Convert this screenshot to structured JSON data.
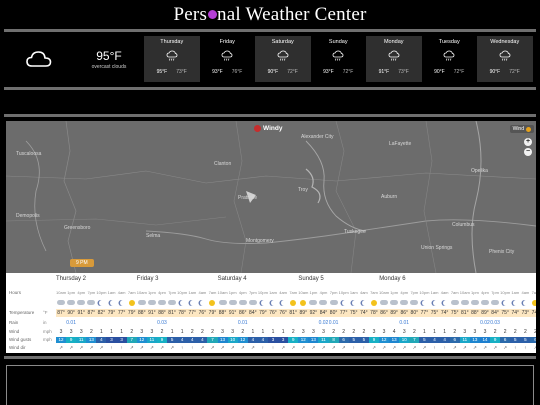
{
  "title": {
    "before": "Pers",
    "after": "nal Weather Center"
  },
  "current": {
    "icon": "cloud-icon",
    "temp": "95°F",
    "condition": "overcast clouds"
  },
  "days": [
    {
      "name": "Thursday",
      "high": "95°F",
      "low": "73°F",
      "icon": "rain-cloud-icon"
    },
    {
      "name": "Friday",
      "high": "93°F",
      "low": "76°F",
      "icon": "rain-cloud-icon"
    },
    {
      "name": "Saturday",
      "high": "90°F",
      "low": "72°F",
      "icon": "rain-cloud-icon"
    },
    {
      "name": "Sunday",
      "high": "93°F",
      "low": "72°F",
      "icon": "rain-cloud-icon"
    },
    {
      "name": "Monday",
      "high": "91°F",
      "low": "73°F",
      "icon": "rain-cloud-icon"
    },
    {
      "name": "Tuesday",
      "high": "90°F",
      "low": "72°F",
      "icon": "rain-cloud-icon"
    },
    {
      "name": "Wednesday",
      "high": "90°F",
      "low": "72°F",
      "icon": "rain-cloud-icon"
    }
  ],
  "map": {
    "brand": "Windy",
    "layer_button": "Wind",
    "zoom_in": "+",
    "zoom_out": "−",
    "time_marker": "9 PM",
    "cities": [
      "Tuscaloosa",
      "Alexander City",
      "LaFayette",
      "Opelika",
      "Auburn",
      "Tuskegee",
      "Montgomery",
      "Prattville",
      "Selma",
      "Clanton",
      "Columbus",
      "Phenix City",
      "Demopolis",
      "Greensboro",
      "Troy",
      "Union Springs"
    ]
  },
  "forecast": {
    "day_labels": [
      "Thursday 2",
      "Friday 3",
      "Saturday 4",
      "Sunday 5",
      "Monday 6"
    ],
    "row_labels": {
      "hours": "Hours",
      "temp": "Temperature",
      "rain": "Rain",
      "wind": "Wind",
      "gusts": "Wind gusts",
      "dir": "Wind dir"
    },
    "units": {
      "hours": "",
      "temp": "°F",
      "rain": "in",
      "wind": "mph",
      "gusts": "mph",
      "dir": ""
    },
    "hours": [
      "10am",
      "1pm",
      "4pm",
      "7pm",
      "10pm",
      "1am",
      "4am",
      "7am",
      "10am",
      "1pm",
      "4pm",
      "7pm",
      "10pm",
      "1am",
      "4am",
      "7am",
      "10am",
      "1pm",
      "4pm",
      "7pm",
      "10pm",
      "1am",
      "4am",
      "7am",
      "10am",
      "1pm",
      "4pm",
      "7pm",
      "10pm",
      "1am",
      "4am",
      "7am",
      "10am",
      "1pm",
      "4pm",
      "7pm",
      "10pm",
      "1am",
      "4am",
      "7am",
      "10am",
      "1pm",
      "4pm",
      "7pm",
      "10pm",
      "1am",
      "4am",
      "7am"
    ],
    "icons": [
      "pcloud",
      "pcloud",
      "pcloud",
      "pcloud",
      "moon",
      "moon",
      "moon",
      "sun",
      "pcloud",
      "pcloud",
      "pcloud",
      "pcloud",
      "moon",
      "moon",
      "moon",
      "sun",
      "pcloud",
      "pcloud",
      "pcloud",
      "pcloud",
      "moon",
      "moon",
      "moon",
      "sun",
      "sun",
      "pcloud",
      "pcloud",
      "pcloud",
      "moon",
      "moon",
      "moon",
      "sun",
      "pcloud",
      "pcloud",
      "pcloud",
      "pcloud",
      "moon",
      "moon",
      "moon",
      "pcloud",
      "pcloud",
      "pcloud",
      "pcloud",
      "pcloud",
      "moon",
      "moon",
      "moon",
      "sun"
    ],
    "temps": [
      "87°",
      "90°",
      "91°",
      "87°",
      "82°",
      "79°",
      "77°",
      "79°",
      "88°",
      "91°",
      "88°",
      "81°",
      "78°",
      "77°",
      "76°",
      "79°",
      "88°",
      "91°",
      "86°",
      "84°",
      "79°",
      "76°",
      "76°",
      "81°",
      "89°",
      "92°",
      "84°",
      "80°",
      "77°",
      "75°",
      "74°",
      "78°",
      "86°",
      "89°",
      "86°",
      "80°",
      "77°",
      "75°",
      "74°",
      "75°",
      "81°",
      "88°",
      "89°",
      "84°",
      "75°",
      "74°",
      "73°",
      "74°"
    ],
    "rain": [
      "",
      "0.01",
      "",
      "",
      "",
      "",
      "",
      "",
      "",
      "",
      "0.03",
      "",
      "",
      "",
      "",
      "",
      "",
      "",
      "0.01",
      "",
      "",
      "",
      "",
      "",
      "",
      "",
      "0.02",
      "0.01",
      "",
      "",
      "",
      "",
      "",
      "",
      "0.01",
      "",
      "",
      "",
      "",
      "",
      "",
      "",
      "0.02",
      "0.03",
      "",
      "",
      "",
      ""
    ],
    "wind": [
      "3",
      "3",
      "3",
      "2",
      "1",
      "1",
      "1",
      "2",
      "3",
      "3",
      "2",
      "1",
      "1",
      "2",
      "2",
      "2",
      "3",
      "3",
      "2",
      "1",
      "1",
      "1",
      "1",
      "2",
      "3",
      "3",
      "3",
      "2",
      "2",
      "2",
      "2",
      "3",
      "3",
      "4",
      "3",
      "2",
      "1",
      "1",
      "1",
      "2",
      "3",
      "3",
      "3",
      "2",
      "2",
      "2",
      "2",
      "2"
    ],
    "gusts": [
      "12",
      "9",
      "11",
      "13",
      "4",
      "3",
      "3",
      "7",
      "12",
      "11",
      "9",
      "5",
      "4",
      "4",
      "4",
      "7",
      "13",
      "10",
      "12",
      "4",
      "4",
      "3",
      "3",
      "9",
      "12",
      "13",
      "11",
      "8",
      "6",
      "5",
      "5",
      "9",
      "12",
      "13",
      "10",
      "7",
      "5",
      "4",
      "4",
      "6",
      "11",
      "13",
      "14",
      "9",
      "6",
      "5",
      "5",
      "6"
    ],
    "gust_colors": [
      "#1f8fd1",
      "#17b0c4",
      "#1aa7c8",
      "#1f8fd1",
      "#2b5fa8",
      "#2a4fa0",
      "#2a4fa0",
      "#21a7b6",
      "#1f8fd1",
      "#1aa7c8",
      "#17b0c4",
      "#2b5fa8",
      "#2b5fa8",
      "#2b5fa8",
      "#2b5fa8",
      "#21a7b6",
      "#1e86cf",
      "#1aa7c8",
      "#1f8fd1",
      "#2b5fa8",
      "#2b5fa8",
      "#2a4fa0",
      "#2a4fa0",
      "#17b0c4",
      "#1f8fd1",
      "#1e86cf",
      "#1aa7c8",
      "#21a7b6",
      "#2b6aab",
      "#2b5fa8",
      "#2b5fa8",
      "#17b0c4",
      "#1f8fd1",
      "#1e86cf",
      "#1aa7c8",
      "#21a7b6",
      "#2b5fa8",
      "#2b5fa8",
      "#2b5fa8",
      "#2b6aab",
      "#1aa7c8",
      "#1e86cf",
      "#1d7fcf",
      "#17b0c4",
      "#2b6aab",
      "#2b5fa8",
      "#2b5fa8",
      "#2b6aab"
    ],
    "dirs": [
      "↗",
      "↗",
      "↗",
      "↗",
      "↗",
      "↑",
      "↑",
      "↗",
      "↗",
      "↗",
      "↗",
      "↗",
      "↑",
      "↑",
      "↗",
      "↗",
      "↗",
      "↗",
      "↗",
      "↗",
      "↑",
      "↑",
      "↗",
      "↗",
      "↗",
      "↗",
      "↗",
      "↗",
      "↗",
      "↑",
      "↑",
      "↗",
      "↗",
      "↗",
      "↗",
      "↗",
      "↗",
      "↑",
      "↑",
      "↗",
      "↗",
      "↗",
      "↗",
      "↗",
      "↗",
      "↑",
      "↑",
      "↗"
    ]
  }
}
